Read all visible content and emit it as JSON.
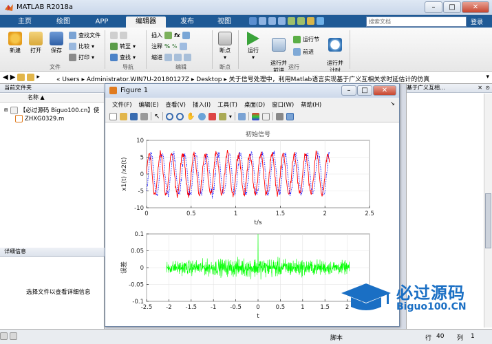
{
  "app": {
    "title": "MATLAB R2018a"
  },
  "tabs": [
    "主页",
    "绘图",
    "APP",
    "编辑器",
    "发布",
    "视图"
  ],
  "active_tab": "编辑器",
  "search": {
    "placeholder": "搜索文档",
    "login_label": "登录"
  },
  "ribbon": {
    "file": {
      "group_label": "文件",
      "new_label": "新建",
      "open_label": "打开",
      "save_label": "保存",
      "find_files_label": "查找文件",
      "compare_label": "比较",
      "print_label": "打印"
    },
    "navigate": {
      "group_label": "导航",
      "goto_label": "转至",
      "find_label": "查找"
    },
    "edit": {
      "group_label": "编辑",
      "insert_label": "插入",
      "comment_label": "注释",
      "indent_label": "缩进"
    },
    "breakpoints": {
      "group_label": "断点",
      "breakpoint_label": "断点"
    },
    "run": {
      "group_label": "运行",
      "run_label": "运行",
      "run_advance_label": "运行并\n前进",
      "run_section_label": "运行节",
      "advance_label": "前进",
      "run_time_label": "运行并\n计时"
    }
  },
  "address": {
    "path": [
      "Users",
      "Administrator.WIN7U-20180127Z",
      "Desktop",
      "关于信号处理中，利用Matlab语言实现基于广义互相关求时延估计的仿真"
    ]
  },
  "left_panel": {
    "title": "当前文件夹",
    "column_header": "名称",
    "sort_indicator": "▲",
    "files": [
      "【必过源码 Biguo100.cn】使",
      "ZHXG0329.m"
    ],
    "details_title": "详细信息",
    "details_hint": "选择文件以查看详细信息"
  },
  "right_panel": {
    "title_snippet": "基于广义互相..."
  },
  "status": {
    "mode_label": "脚本",
    "row_label": "行",
    "row_value": "40",
    "col_label": "列",
    "col_value": "1"
  },
  "figure": {
    "title": "Figure 1",
    "menus": [
      "文件(F)",
      "编辑(E)",
      "查看(V)",
      "插入(I)",
      "工具(T)",
      "桌面(D)",
      "窗口(W)",
      "帮助(H)"
    ]
  },
  "chart_data": [
    {
      "type": "line",
      "title": "初始信号",
      "xlabel": "t/s",
      "ylabel": "x1(t) /x2(t)",
      "xlim": [
        0,
        2.5
      ],
      "ylim": [
        -10,
        10
      ],
      "xticks": [
        0,
        0.5,
        1,
        1.5,
        2,
        2.5
      ],
      "yticks": [
        -10,
        -5,
        0,
        5,
        10
      ],
      "grid": true,
      "series": [
        {
          "style": "solid",
          "color": "#ff0000",
          "t_range": [
            0,
            2.05
          ],
          "amplitude": 6,
          "frequency_hz": 8,
          "noise": 1.5
        },
        {
          "style": "dotted",
          "color": "#0000ff",
          "t_range": [
            0,
            2.05
          ],
          "amplitude": 6,
          "frequency_hz": 8,
          "delay_s": 0.02,
          "noise": 1.5
        }
      ]
    },
    {
      "type": "line",
      "title": "",
      "xlabel": "t",
      "ylabel": "误差",
      "xlim": [
        -2.5,
        2.5
      ],
      "ylim": [
        -0.1,
        0.1
      ],
      "xticks": [
        -2.5,
        -2,
        -1.5,
        -1,
        -0.5,
        0,
        0.5,
        1,
        1.5,
        2,
        2.5
      ],
      "yticks": [
        -0.1,
        -0.05,
        0,
        0.05,
        0.1
      ],
      "grid": true,
      "series": [
        {
          "style": "solid",
          "color": "#00ff00",
          "t_range": [
            -2.05,
            2.05
          ],
          "noise_amplitude": 0.035,
          "peak_at_t": 0,
          "peak_value": 0.1
        }
      ]
    }
  ],
  "watermark": {
    "text_cn": "必过源码",
    "text_en": "Biguo100.CN"
  },
  "colors": {
    "tabbar": "#1f5a96",
    "ribbon_bg": "#f0f0f0",
    "accent": "#1f6fb5"
  }
}
